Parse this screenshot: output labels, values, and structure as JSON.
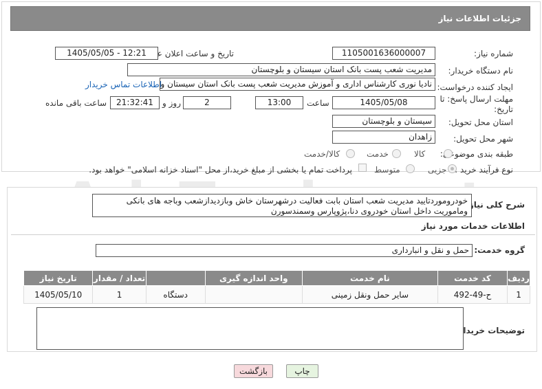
{
  "header": {
    "title": "جزئیات اطلاعات نیاز"
  },
  "fields": {
    "need_number_label": "شماره نیاز:",
    "need_number": "1105001636000007",
    "announce_label": "تاریخ و ساعت اعلان عمومی:",
    "announce_value": "1405/05/05 - 12:21",
    "buyer_org_label": "نام دستگاه خریدار:",
    "buyer_org": "مدیریت شعب پست بانک استان سیستان و بلوچستان",
    "creator_label": "ایجاد کننده درخواست:",
    "creator": "نادیا نوری کارشناس اداری و آموزش  مدیریت شعب پست بانک استان سیستان و بلوچستان",
    "contact_link": "اطلاعات تماس خریدار",
    "deadline_label": "مهلت ارسال پاسخ: تا تاریخ:",
    "deadline_date": "1405/05/08",
    "time_label": "ساعت",
    "deadline_time": "13:00",
    "days_value": "2",
    "days_label": "روز و",
    "remaining_time": "21:32:41",
    "remaining_label": "ساعت باقی مانده",
    "province_label": "استان محل تحویل:",
    "province": "سیستان و بلوچستان",
    "city_label": "شهر محل تحویل:",
    "city": "زاهدان",
    "category_label": "طبقه بندی موضوعی:",
    "category_options": [
      "کالا",
      "خدمت",
      "کالا/خدمت"
    ],
    "purchase_type_label": "نوع فرآیند خرید :",
    "purchase_options": [
      "جزیی",
      "متوسط"
    ],
    "payment_note": "پرداخت تمام یا بخشی از مبلغ خرید،از محل \"اسناد خزانه اسلامی\" خواهد بود."
  },
  "summary": {
    "label": "شرح کلی نیاز:",
    "text": "خودروموردتایید مدیریت شعب استان بابت فعالیت درشهرستان خاش  وبازدیدازشعب وباجه های بانکی وماموریت داخل استان خودروی دنا،پژوپارس وسمندسورن"
  },
  "services": {
    "section_title": "اطلاعات خدمات مورد نیاز",
    "group_label": "گروه خدمت:",
    "group_value": "حمل و نقل و انبارداری",
    "columns": [
      "ردیف",
      "کد خدمت",
      "نام خدمت",
      "واحد اندازه گیری",
      "تعداد / مقدار",
      "تاریخ نیاز"
    ],
    "rows": [
      {
        "row": "1",
        "code": "ح-49-492",
        "name": "سایر حمل ونقل زمینی",
        "unit": "دستگاه",
        "qty": "1",
        "date": "1405/05/10"
      }
    ]
  },
  "buyer_notes": {
    "label": "توضیحات خریدار:",
    "value": ""
  },
  "buttons": {
    "print": "چاپ",
    "back": "بازگشت"
  },
  "watermark": "AriaTender.net",
  "colors": {
    "header_bg": "#8a8a8a",
    "link": "#1a64b6",
    "back_btn": "#f7d9dc",
    "print_btn": "#e6f4e0"
  }
}
